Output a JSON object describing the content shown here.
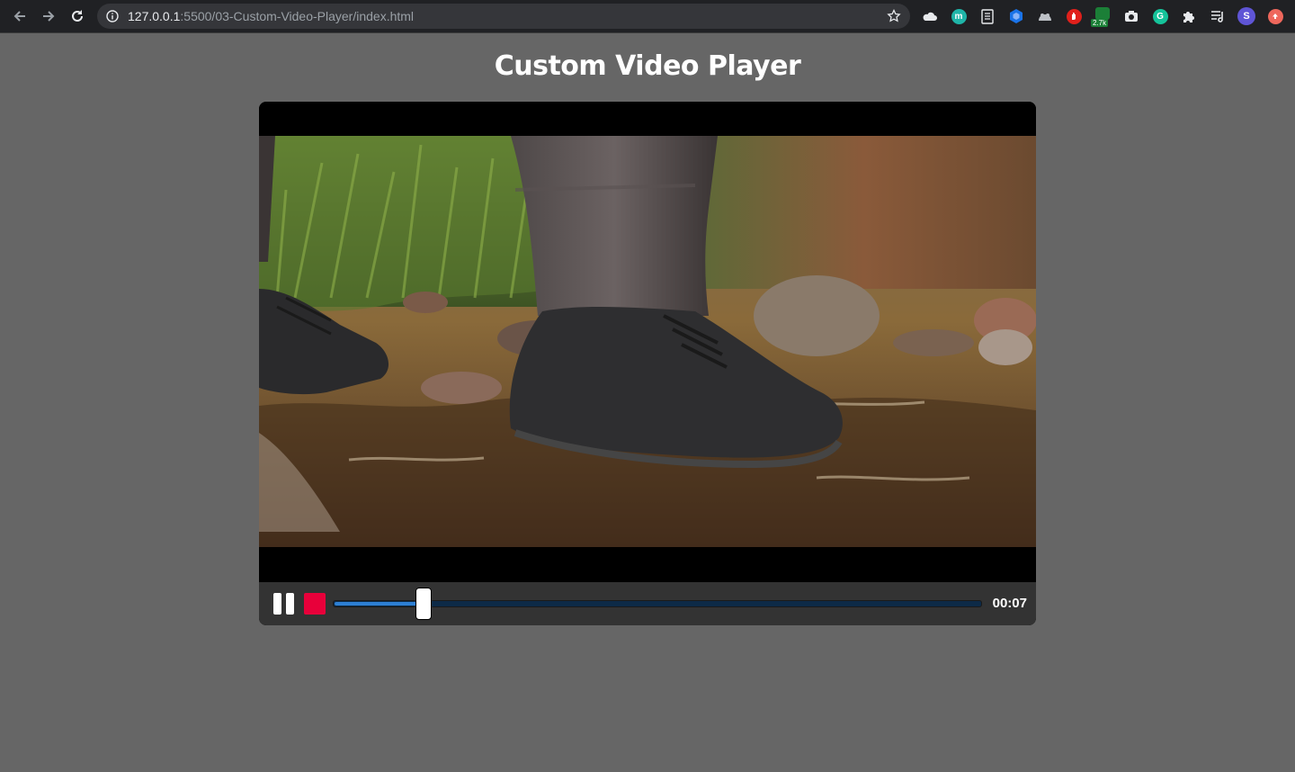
{
  "browser": {
    "url_host": "127.0.0.1",
    "url_rest": ":5500/03-Custom-Video-Player/index.html",
    "extensions": [
      {
        "name": "cloud-extension-icon"
      },
      {
        "name": "m-extension-icon",
        "label": "m",
        "color": "#1fb5a8"
      },
      {
        "name": "document-extension-icon"
      },
      {
        "name": "hexagon-extension-icon",
        "color": "#1a73e8"
      },
      {
        "name": "cat-extension-icon"
      },
      {
        "name": "red-hand-extension-icon",
        "color": "#e0201b"
      },
      {
        "name": "counter-extension-icon",
        "badge": "2.7k"
      },
      {
        "name": "camera-extension-icon"
      },
      {
        "name": "grammarly-extension-icon",
        "label": "G",
        "color": "#15c39a"
      },
      {
        "name": "puzzle-extension-icon"
      },
      {
        "name": "reading-list-icon"
      },
      {
        "name": "profile-avatar",
        "label": "S",
        "color": "#5f55d6"
      },
      {
        "name": "update-icon",
        "color": "#ee675c"
      }
    ]
  },
  "page": {
    "title": "Custom Video Player"
  },
  "player": {
    "progress": 0.138,
    "time": "00:07",
    "state": "playing",
    "accent_color": "#e8003a",
    "progress_color": "#2d7fd3"
  }
}
